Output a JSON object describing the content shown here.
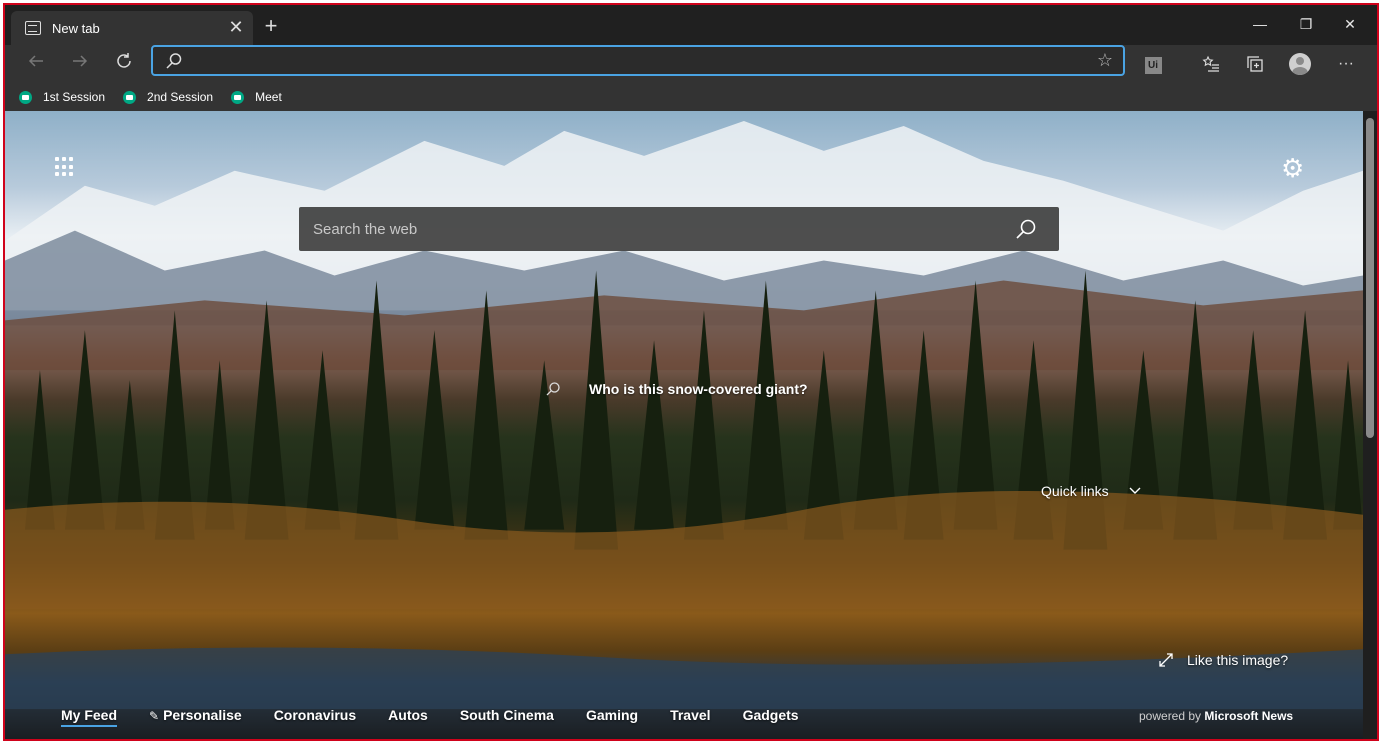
{
  "tab": {
    "title": "New tab",
    "close": "✕",
    "new": "+"
  },
  "window": {
    "minimize": "—",
    "restore": "❐",
    "close": "✕"
  },
  "address": {
    "value": "",
    "star": "☆"
  },
  "toolbar": {
    "ext_label": "Ui",
    "more": "···"
  },
  "favorites": [
    {
      "label": "1st Session",
      "icon": "meet-icon"
    },
    {
      "label": "2nd Session",
      "icon": "meet-icon"
    },
    {
      "label": "Meet",
      "icon": "meet-icon"
    }
  ],
  "search": {
    "placeholder": "Search the web"
  },
  "hero": {
    "question": "Who is this snow-covered giant?",
    "quick_links": "Quick links",
    "like_image": "Like this image?"
  },
  "feed": {
    "tabs": [
      "My Feed",
      "Personalise",
      "Coronavirus",
      "Autos",
      "South Cinema",
      "Gaming",
      "Travel",
      "Gadgets"
    ],
    "powered_prefix": "powered by",
    "powered_brand": "Microsoft News"
  },
  "colors": {
    "accent": "#4aa3e3",
    "frame_border": "#d0021b",
    "chrome": "#333333"
  }
}
